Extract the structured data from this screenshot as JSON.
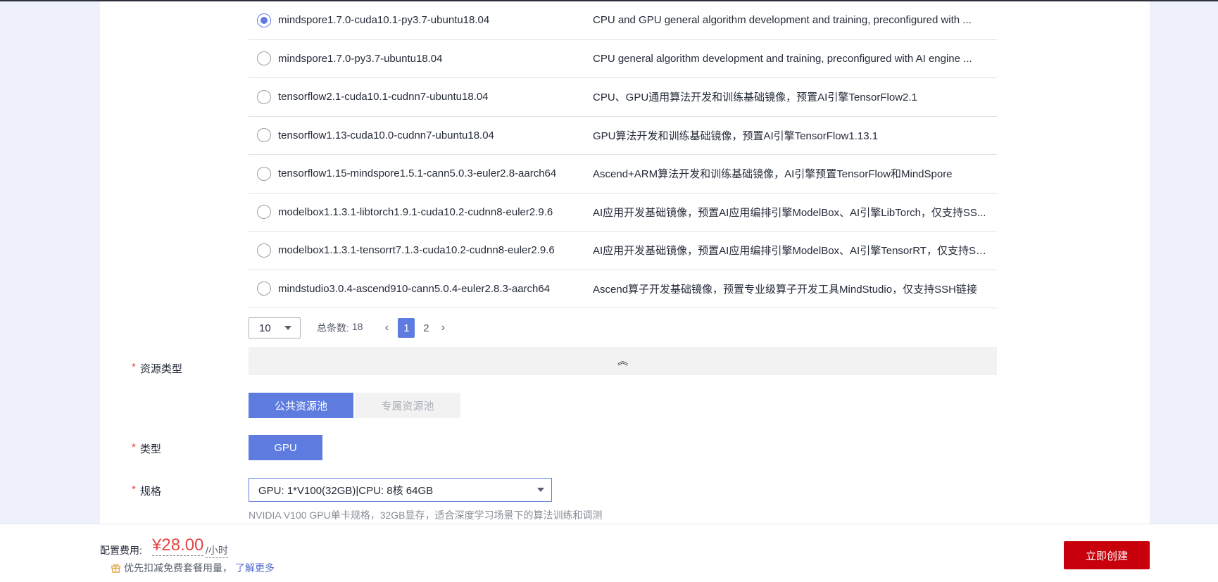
{
  "images": [
    {
      "name": "mindspore1.7.0-cuda10.1-py3.7-ubuntu18.04",
      "desc": "CPU and GPU general algorithm development and training, preconfigured with ...",
      "selected": true
    },
    {
      "name": "mindspore1.7.0-py3.7-ubuntu18.04",
      "desc": "CPU general algorithm development and training, preconfigured with AI engine ...",
      "selected": false
    },
    {
      "name": "tensorflow2.1-cuda10.1-cudnn7-ubuntu18.04",
      "desc": "CPU、GPU通用算法开发和训练基础镜像，预置AI引擎TensorFlow2.1",
      "selected": false
    },
    {
      "name": "tensorflow1.13-cuda10.0-cudnn7-ubuntu18.04",
      "desc": "GPU算法开发和训练基础镜像，预置AI引擎TensorFlow1.13.1",
      "selected": false
    },
    {
      "name": "tensorflow1.15-mindspore1.5.1-cann5.0.3-euler2.8-aarch64",
      "desc": "Ascend+ARM算法开发和训练基础镜像，AI引擎预置TensorFlow和MindSpore",
      "selected": false
    },
    {
      "name": "modelbox1.1.3.1-libtorch1.9.1-cuda10.2-cudnn8-euler2.9.6",
      "desc": "AI应用开发基础镜像，预置AI应用编排引擎ModelBox、AI引擎LibTorch，仅支持SS...",
      "selected": false
    },
    {
      "name": "modelbox1.1.3.1-tensorrt7.1.3-cuda10.2-cudnn8-euler2.9.6",
      "desc": "AI应用开发基础镜像，预置AI应用编排引擎ModelBox、AI引擎TensorRT，仅支持SS...",
      "selected": false
    },
    {
      "name": "mindstudio3.0.4-ascend910-cann5.0.4-euler2.8.3-aarch64",
      "desc": "Ascend算子开发基础镜像，预置专业级算子开发工具MindStudio，仅支持SSH链接",
      "selected": false
    }
  ],
  "pagination": {
    "page_size": "10",
    "total_label": "总条数:",
    "total": "18",
    "prev": "‹",
    "next": "›",
    "pages": [
      "1",
      "2"
    ],
    "current": "1"
  },
  "collapse_icon": "double-chevron-up",
  "collapse_glyph": "︽",
  "form": {
    "resource_type": {
      "label": "资源类型",
      "options": [
        "公共资源池",
        "专属资源池"
      ]
    },
    "type": {
      "label": "类型",
      "option": "GPU"
    },
    "spec": {
      "label": "规格",
      "value": "GPU: 1*V100(32GB)|CPU: 8核 64GB",
      "hint": "NVIDIA V100 GPU单卡规格，32GB显存，适合深度学习场景下的算法训练和调测"
    },
    "required_mark": "*"
  },
  "footer": {
    "fee_label": "配置费用:",
    "fee_amount": "¥28.00",
    "fee_unit": "/小时",
    "promo_text": "优先扣减免费套餐用量，",
    "learn_more": "了解更多",
    "create_button": "立即创建"
  },
  "colors": {
    "accent": "#5e7ce0",
    "danger": "#c7000b",
    "price": "#e54545"
  }
}
